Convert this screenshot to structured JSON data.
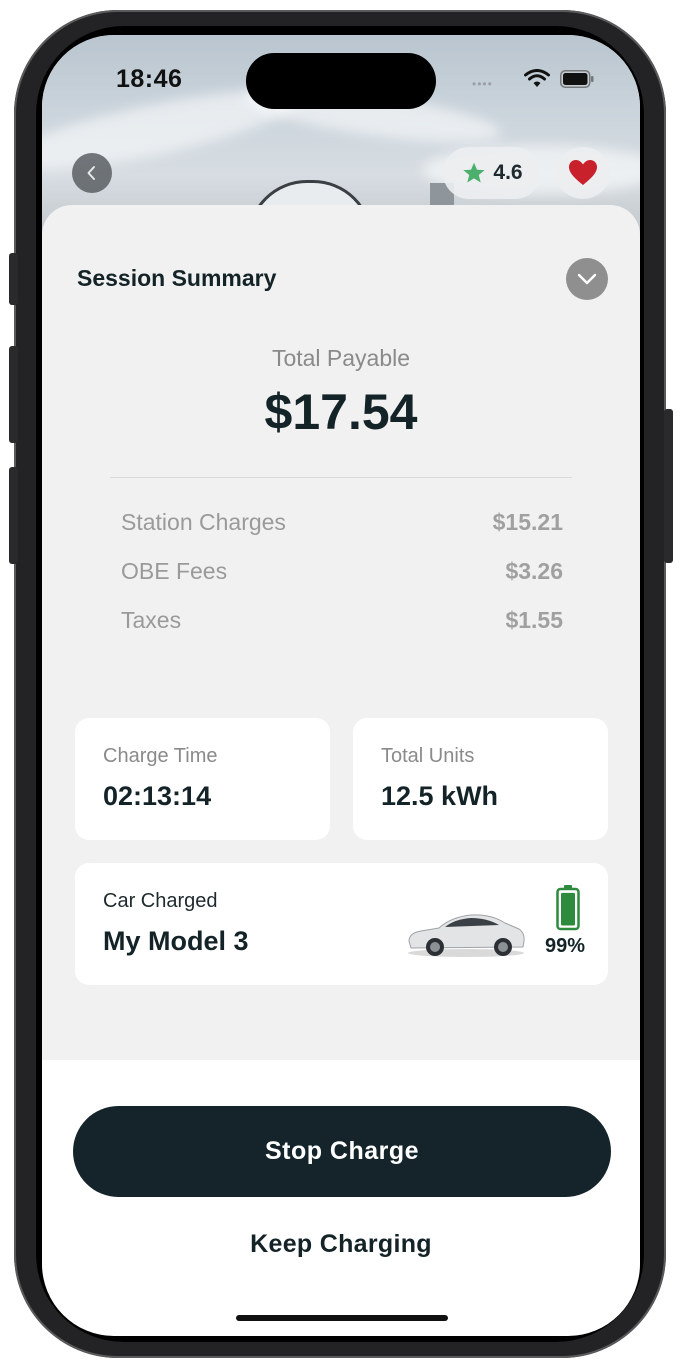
{
  "status": {
    "time": "18:46",
    "signal_dots": "••••"
  },
  "header": {
    "rating": "4.6"
  },
  "session": {
    "title": "Session Summary",
    "total_label": "Total Payable",
    "total_amount": "$17.54",
    "charges": [
      {
        "label": "Station Charges",
        "amount": "$15.21"
      },
      {
        "label": "OBE Fees",
        "amount": "$3.26"
      },
      {
        "label": "Taxes",
        "amount": "$1.55"
      }
    ]
  },
  "stats": {
    "charge_time_label": "Charge Time",
    "charge_time_value": "02:13:14",
    "total_units_label": "Total Units",
    "total_units_value": "12.5 kWh"
  },
  "car": {
    "label": "Car Charged",
    "name": "My Model 3",
    "battery_percent": "99%",
    "battery_level": 0.99
  },
  "actions": {
    "stop_label": "Stop Charge",
    "keep_label": "Keep Charging"
  },
  "colors": {
    "primary_dark": "#14242a",
    "rating_star": "#4caf6d",
    "favorite_heart": "#c8212b",
    "battery_green": "#2e8b3d"
  },
  "icons": {
    "back": "chevron-left-icon",
    "rating": "star-icon",
    "favorite": "heart-icon",
    "collapse": "chevron-down-icon",
    "battery": "battery-icon",
    "wifi": "wifi-icon",
    "cell_battery": "status-battery-icon"
  }
}
